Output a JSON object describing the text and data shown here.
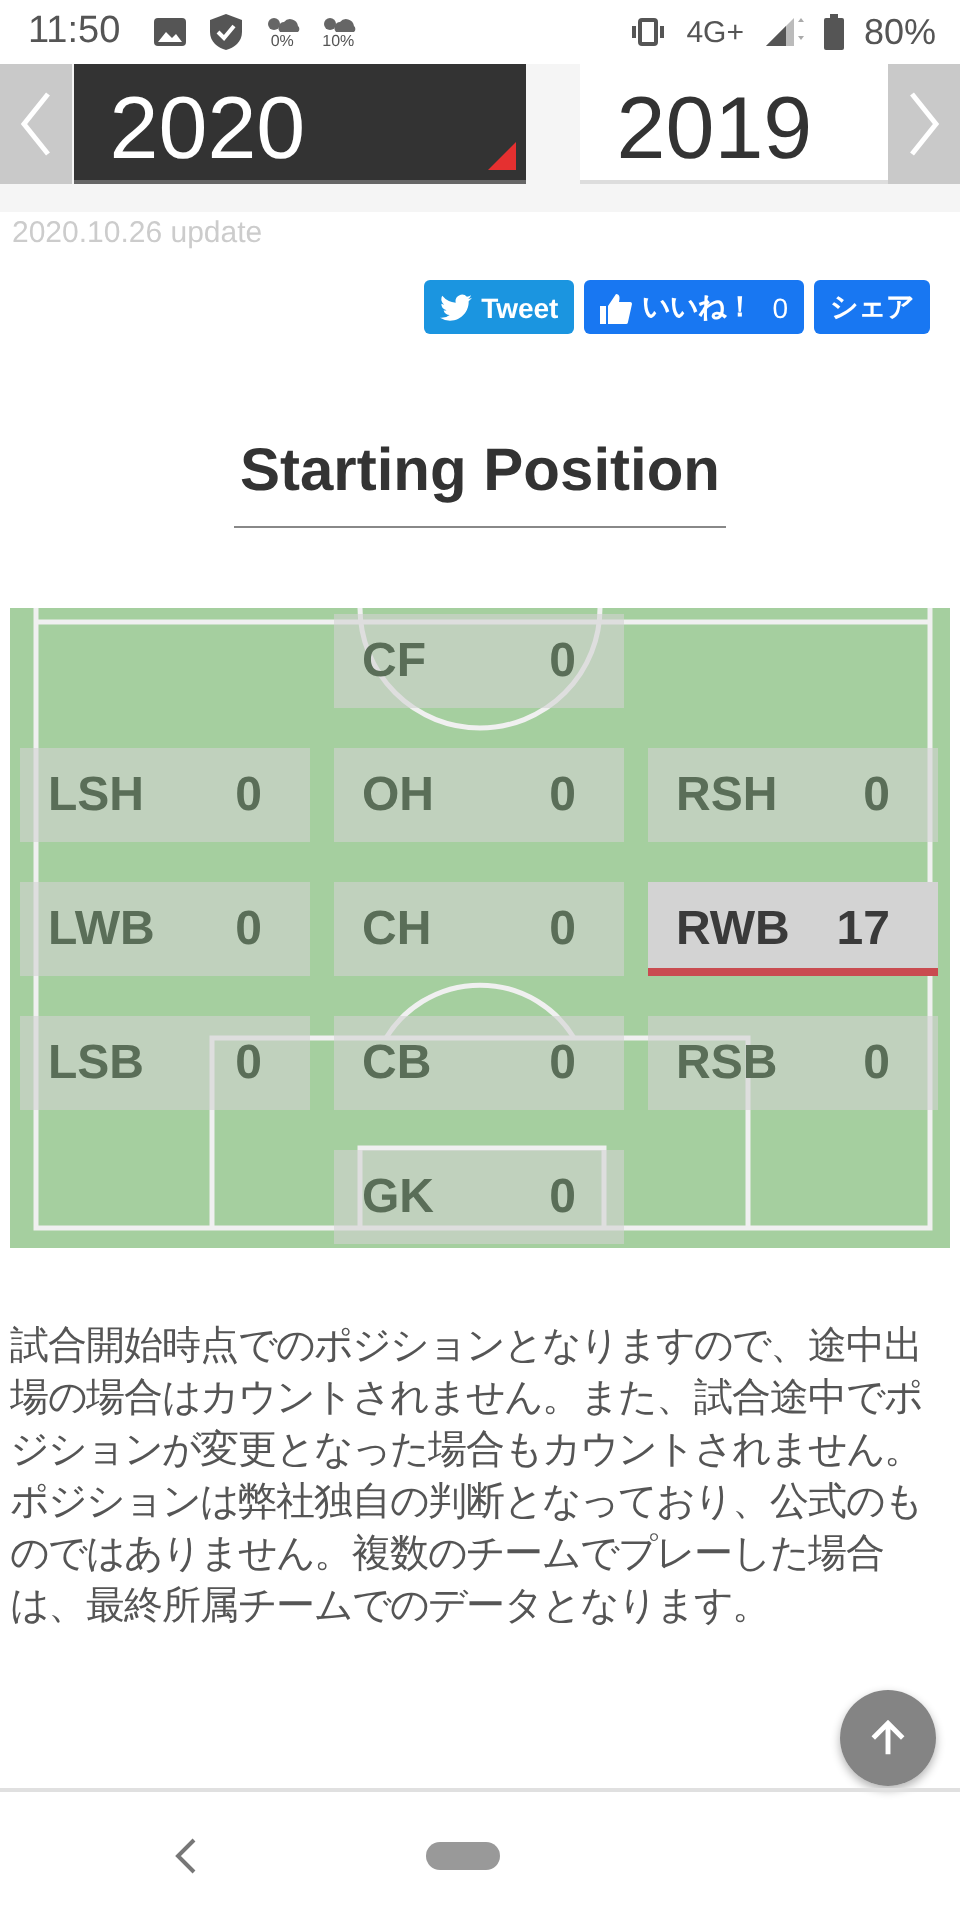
{
  "status_bar": {
    "time": "11:50",
    "weather": [
      {
        "text": "0%"
      },
      {
        "text": "10%"
      }
    ],
    "network": "4G+",
    "battery": "80%"
  },
  "year_tabs": [
    {
      "label": "2020",
      "selected": true
    },
    {
      "label": "2019",
      "selected": false
    }
  ],
  "updated": "2020.10.26 update",
  "share_buttons": [
    {
      "kind": "tweet",
      "label": "Tweet"
    },
    {
      "kind": "like",
      "label": "いいね！",
      "count": "0"
    },
    {
      "kind": "share",
      "label": "シェア"
    }
  ],
  "section_title": "Starting Position",
  "positions": [
    {
      "center": {
        "label": "CF",
        "count": "0",
        "highlighted": false
      }
    },
    {
      "left": {
        "label": "LSH",
        "count": "0",
        "highlighted": false
      },
      "center": {
        "label": "OH",
        "count": "0",
        "highlighted": false
      },
      "right": {
        "label": "RSH",
        "count": "0",
        "highlighted": false
      }
    },
    {
      "left": {
        "label": "LWB",
        "count": "0",
        "highlighted": false
      },
      "center": {
        "label": "CH",
        "count": "0",
        "highlighted": false
      },
      "right": {
        "label": "RWB",
        "count": "17",
        "highlighted": true
      }
    },
    {
      "left": {
        "label": "LSB",
        "count": "0",
        "highlighted": false
      },
      "center": {
        "label": "CB",
        "count": "0",
        "highlighted": false
      },
      "right": {
        "label": "RSB",
        "count": "0",
        "highlighted": false
      }
    },
    {
      "center": {
        "label": "GK",
        "count": "0",
        "highlighted": false
      }
    }
  ],
  "note": "試合開始時点でのポジションとなりますので、途中出場の場合はカウントされません。また、試合途中でポジションが変更となった場合もカウントされません。ポジションは弊社独自の判断となっており、公式のものではありません。複数のチームでプレーした場合は、最終所属チームでのデータとなります。"
}
